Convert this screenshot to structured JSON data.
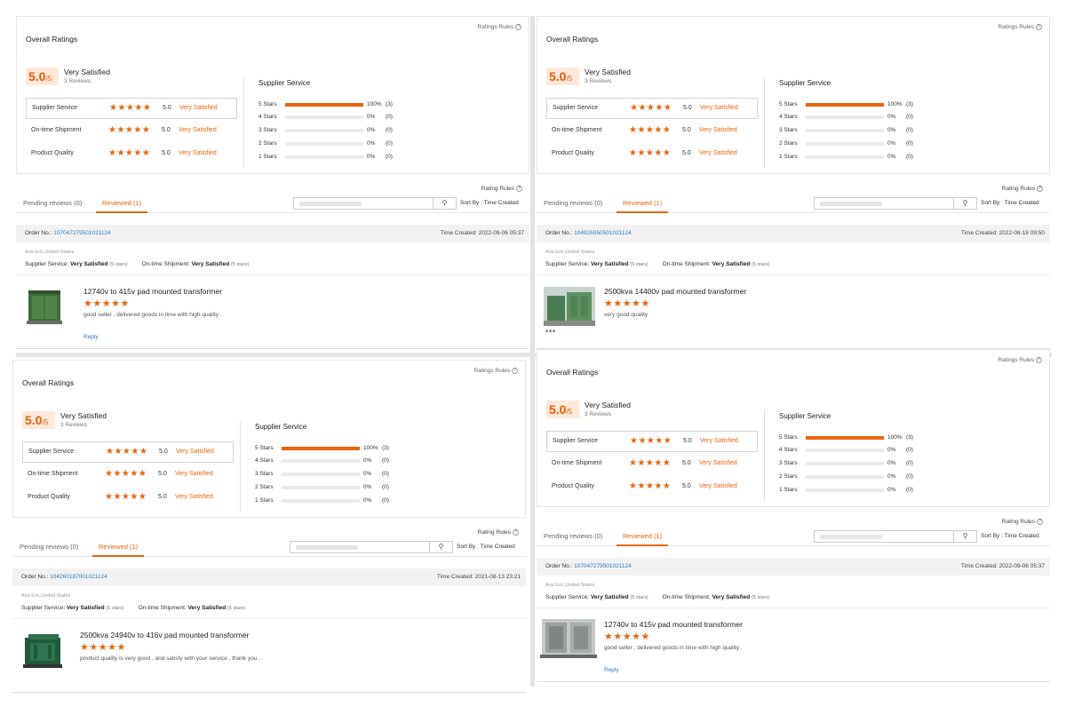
{
  "panels": [
    {
      "overall_title": "Overall Ratings",
      "ratings_rules": "Ratings Rules",
      "score": "5.0",
      "score_max": "/5",
      "satisfaction": "Very Satisfied",
      "reviews_count": "3 Reviews",
      "categories": [
        {
          "name": "Supplier Service",
          "stars": "★★★★★",
          "value": "5.0",
          "label": "Very Satisfied"
        },
        {
          "name": "On-time Shipment",
          "stars": "★★★★★",
          "value": "5.0",
          "label": "Very Satisfied"
        },
        {
          "name": "Product Quality",
          "stars": "★★★★★",
          "value": "5.0",
          "label": "Very Satisfied"
        }
      ],
      "supplier_service_title": "Supplier Service",
      "distribution": [
        {
          "label": "5 Stars",
          "fraction": 1.0,
          "pct": "100%",
          "count": "(3)"
        },
        {
          "label": "4 Stars",
          "fraction": 0,
          "pct": "0%",
          "count": "(0)"
        },
        {
          "label": "3 Stars",
          "fraction": 0,
          "pct": "0%",
          "count": "(0)"
        },
        {
          "label": "2 Stars",
          "fraction": 0,
          "pct": "0%",
          "count": "(0)"
        },
        {
          "label": "1 Stars",
          "fraction": 0,
          "pct": "0%",
          "count": "(0)"
        }
      ],
      "rating_rules": "Rating Rules",
      "tab_pending": "Pending reviews (0)",
      "tab_reviewed": "Reviewed (1)",
      "search_icon": "search-icon",
      "sort_by": "Sort By : Time Created",
      "order_label": "Order No.:",
      "order_no": "107047279501021124",
      "time_created": "Time Created: 2022-09-06 05:37",
      "buyer": "Aria Eric,United States",
      "supplier_service_label": "Supplier Service:",
      "supplier_service_value": "Very Satisfied",
      "supplier_service_stars": "(5 stars)",
      "shipment_label": "On-time Shipment:",
      "shipment_value": "Very Satisfied",
      "shipment_stars": "(5 stars)",
      "product_title": "12740v to 415v pad mounted transformer",
      "review_stars": "★★★★★",
      "comment": "good seller , delivered goods in time with high quality .",
      "reply": "Reply",
      "image_indicator": ""
    },
    {
      "overall_title": "Overall Ratings",
      "ratings_rules": "Ratings Rules",
      "score": "5.0",
      "score_max": "/5",
      "satisfaction": "Very Satisfied",
      "reviews_count": "3 Reviews",
      "categories": [
        {
          "name": "Supplier Service",
          "stars": "★★★★★",
          "value": "5.0",
          "label": "Very Satisfied"
        },
        {
          "name": "On-time Shipment",
          "stars": "★★★★★",
          "value": "5.0",
          "label": "Very Satisfied"
        },
        {
          "name": "Product Quality",
          "stars": "★★★★★",
          "value": "5.0",
          "label": "Very Satisfied"
        }
      ],
      "supplier_service_title": "Supplier Service",
      "distribution": [
        {
          "label": "5 Stars",
          "fraction": 1.0,
          "pct": "100%",
          "count": "(3)"
        },
        {
          "label": "4 Stars",
          "fraction": 0,
          "pct": "0%",
          "count": "(0)"
        },
        {
          "label": "3 Stars",
          "fraction": 0,
          "pct": "0%",
          "count": "(0)"
        },
        {
          "label": "2 Stars",
          "fraction": 0,
          "pct": "0%",
          "count": "(0)"
        },
        {
          "label": "1 Stars",
          "fraction": 0,
          "pct": "0%",
          "count": "(0)"
        }
      ],
      "rating_rules": "Rating Rules",
      "tab_pending": "Pending reviews (0)",
      "tab_reviewed": "Reviewed (1)",
      "search_icon": "search-icon",
      "sort_by": "Sort By : Time Created",
      "order_label": "Order No.:",
      "order_no": "104926950501021124",
      "time_created": "Time Created: 2022-08-18 09:50",
      "buyer": "Aria Eric,United States",
      "supplier_service_label": "Supplier Service:",
      "supplier_service_value": "Very Satisfied",
      "supplier_service_stars": "(5 stars)",
      "shipment_label": "On-time Shipment:",
      "shipment_value": "Very Satisfied",
      "shipment_stars": "(5 stars)",
      "product_title": "2500kva 14400v pad mounted transformer",
      "review_stars": "★★★★★",
      "comment": "very good quality",
      "reply": "",
      "image_indicator": "■■■"
    },
    {
      "overall_title": "Overall Ratings",
      "ratings_rules": "Ratings Rules",
      "score": "5.0",
      "score_max": "/5",
      "satisfaction": "Very Satisfied",
      "reviews_count": "3 Reviews",
      "categories": [
        {
          "name": "Supplier Service",
          "stars": "★★★★★",
          "value": "5.0",
          "label": "Very Satisfied"
        },
        {
          "name": "On-time Shipment",
          "stars": "★★★★★",
          "value": "5.0",
          "label": "Very Satisfied"
        },
        {
          "name": "Product Quality",
          "stars": "★★★★★",
          "value": "5.0",
          "label": "Very Satisfied"
        }
      ],
      "supplier_service_title": "Supplier Service",
      "distribution": [
        {
          "label": "5 Stars",
          "fraction": 1.0,
          "pct": "100%",
          "count": "(3)"
        },
        {
          "label": "4 Stars",
          "fraction": 0,
          "pct": "0%",
          "count": "(0)"
        },
        {
          "label": "3 Stars",
          "fraction": 0,
          "pct": "0%",
          "count": "(0)"
        },
        {
          "label": "2 Stars",
          "fraction": 0,
          "pct": "0%",
          "count": "(0)"
        },
        {
          "label": "1 Stars",
          "fraction": 0,
          "pct": "0%",
          "count": "(0)"
        }
      ],
      "rating_rules": "Rating Rules",
      "tab_pending": "Pending reviews (0)",
      "tab_reviewed": "Reviewed (1)",
      "search_icon": "search-icon",
      "sort_by": "Sort By : Time Created",
      "order_label": "Order No.:",
      "order_no": "104260187001021124",
      "time_created": "Time Created: 2021-08-13 23:21",
      "buyer": "Aria Eric,United States",
      "supplier_service_label": "Supplier Service:",
      "supplier_service_value": "Very Satisfied",
      "supplier_service_stars": "(5 stars)",
      "shipment_label": "On-time Shipment:",
      "shipment_value": "Very Satisfied",
      "shipment_stars": "(5 stars)",
      "product_title": "2500kva 24940v to 416v pad mounted transformer",
      "review_stars": "★★★★★",
      "comment": "product quality is very good , and satisfy with your service , thank you .",
      "reply": "",
      "image_indicator": ""
    },
    {
      "overall_title": "Overall Ratings",
      "ratings_rules": "Ratings Rules",
      "score": "5.0",
      "score_max": "/5",
      "satisfaction": "Very Satisfied",
      "reviews_count": "3 Reviews",
      "categories": [
        {
          "name": "Supplier Service",
          "stars": "★★★★★",
          "value": "5.0",
          "label": "Very Satisfied"
        },
        {
          "name": "On-time Shipment",
          "stars": "★★★★★",
          "value": "5.0",
          "label": "Very Satisfied"
        },
        {
          "name": "Product Quality",
          "stars": "★★★★★",
          "value": "5.0",
          "label": "Very Satisfied"
        }
      ],
      "supplier_service_title": "Supplier Service",
      "distribution": [
        {
          "label": "5 Stars",
          "fraction": 1.0,
          "pct": "100%",
          "count": "(3)"
        },
        {
          "label": "4 Stars",
          "fraction": 0,
          "pct": "0%",
          "count": "(0)"
        },
        {
          "label": "3 Stars",
          "fraction": 0,
          "pct": "0%",
          "count": "(0)"
        },
        {
          "label": "2 Stars",
          "fraction": 0,
          "pct": "0%",
          "count": "(0)"
        },
        {
          "label": "1 Stars",
          "fraction": 0,
          "pct": "0%",
          "count": "(0)"
        }
      ],
      "rating_rules": "Rating Rules",
      "tab_pending": "Pending reviews (0)",
      "tab_reviewed": "Reviewed (1)",
      "search_icon": "search-icon",
      "sort_by": "Sort By : Time Created",
      "order_label": "Order No.:",
      "order_no": "107047279501021124",
      "time_created": "Time Created: 2022-09-06 05:37",
      "buyer": "Aria Eric,United States",
      "supplier_service_label": "Supplier Service:",
      "supplier_service_value": "Very Satisfied",
      "supplier_service_stars": "(5 stars)",
      "shipment_label": "On-time Shipment:",
      "shipment_value": "Very Satisfied",
      "shipment_stars": "(5 stars)",
      "product_title": "12740v to 415v pad mounted transformer",
      "review_stars": "★★★★★",
      "comment": "good seller , delivered goods in time with high quality .",
      "reply": "Reply",
      "image_indicator": ""
    }
  ],
  "colors": {
    "accent": "#e8650f",
    "link": "#2b7bbf",
    "score_bg": "#fde8d9"
  }
}
